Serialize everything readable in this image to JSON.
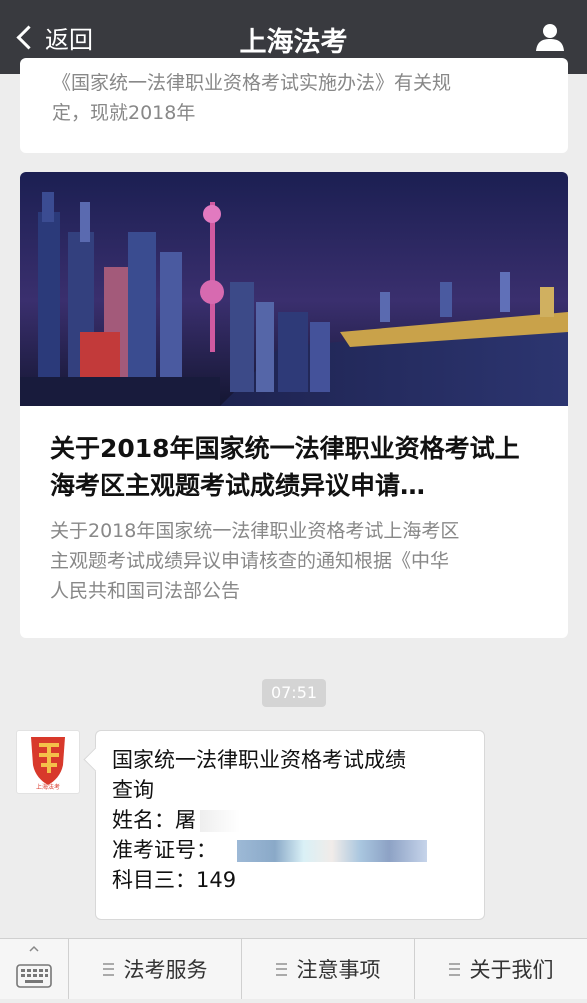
{
  "navbar": {
    "back_label": "返回",
    "title": "上海法考",
    "user_icon": "user-icon"
  },
  "article_top": {
    "summary_line1": "《国家统一法律职业资格考试实施办法》有关规",
    "summary_line2": "定，现就2018年"
  },
  "article_main": {
    "hero_image": "shanghai-skyline-night",
    "title": "关于2018年国家统一法律职业资格考试上海考区主观题考试成绩异议申请…",
    "summary_line1": "关于2018年国家统一法律职业资格考试上海考区",
    "summary_line2": "主观题考试成绩异议申请核查的通知根据《中华",
    "summary_line3": "人民共和国司法部公告"
  },
  "timestamp": "07:51",
  "message": {
    "avatar_text": "上海法考",
    "line1": "国家统一法律职业资格考试成绩",
    "line2": "查询",
    "name_label": "姓名：",
    "name_value": "屠",
    "ticket_label": "准考证号：",
    "subject_label": "科目三：",
    "subject_value": "149"
  },
  "bottom_menu": {
    "keyboard_icon": "keyboard-icon",
    "items": [
      {
        "label": "法考服务"
      },
      {
        "label": "注意事项"
      },
      {
        "label": "关于我们"
      }
    ]
  }
}
